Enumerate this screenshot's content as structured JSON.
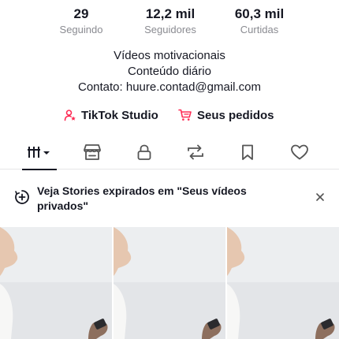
{
  "stats": [
    {
      "value": "29",
      "label": "Seguindo"
    },
    {
      "value": "12,2 mil",
      "label": "Seguidores"
    },
    {
      "value": "60,3 mil",
      "label": "Curtidas"
    }
  ],
  "bio": {
    "line1": "Vídeos motivacionais",
    "line2": "Conteúdo diário",
    "line3": "Contato: huure.contad@gmail.com"
  },
  "links": {
    "studio_label": "TikTok Studio",
    "orders_label": "Seus pedidos"
  },
  "tabs": [
    {
      "name": "videos-grid-tab",
      "icon": "grid-bars-icon"
    },
    {
      "name": "shop-tab",
      "icon": "shop-icon"
    },
    {
      "name": "private-tab",
      "icon": "lock-icon"
    },
    {
      "name": "reposts-tab",
      "icon": "repost-icon"
    },
    {
      "name": "favorites-tab",
      "icon": "bookmark-icon"
    },
    {
      "name": "liked-tab",
      "icon": "heart-icon"
    }
  ],
  "banner": {
    "text": "Veja Stories expirados em \"Seus vídeos privados\""
  },
  "colors": {
    "accent": "#fe2c55",
    "text": "#161823",
    "muted": "#8a8b91"
  }
}
